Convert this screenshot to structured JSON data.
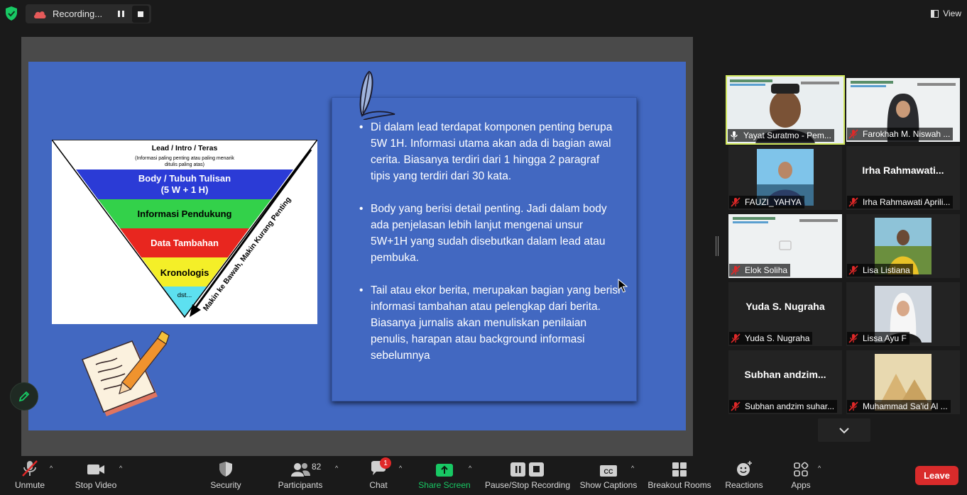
{
  "recording": {
    "label": "Recording..."
  },
  "view": {
    "label": "View"
  },
  "colors": {
    "accent_green": "#18c964",
    "active_speaker": "#d2e85d",
    "leave_red": "#d92b2b",
    "mute_red": "#e02828",
    "slide_blue": "#4268c1"
  },
  "slide": {
    "pyramid": {
      "top_title": "Lead / Intro / Teras",
      "top_note_1": "(Informasi paling penting atau paling menarik",
      "top_note_2": "ditulis paling atas)",
      "body_1": "Body / Tubuh Tulisan",
      "body_2": "(5 W + 1 H)",
      "level_3": "Informasi Pendukung",
      "level_4": "Data Tambahan",
      "level_5": "Kronologis",
      "level_6": "dst...",
      "arrow_label": "Makin ke Bawah, Makin Kurang Penting"
    },
    "bullets": [
      "Di dalam lead terdapat komponen penting berupa 5W 1H. Informasi utama akan ada di bagian awal cerita. Biasanya terdiri dari 1 hingga 2 paragraf tipis yang terdiri dari 30 kata.",
      "Body yang berisi detail penting. Jadi dalam body ada penjelasan lebih lanjut mengenai unsur 5W+1H yang sudah disebutkan dalam lead atau pembuka.",
      "Tail atau ekor berita, merupakan bagian yang berisi informasi tambahan atau pelengkap dari berita. Biasanya jurnalis akan menuliskan penilaian penulis, harapan atau background informasi sebelumnya"
    ]
  },
  "participants": [
    {
      "label": "Yayat Suratmo - Pem...",
      "muted": false,
      "active": true
    },
    {
      "label": "Farokhah M. Niswah ...",
      "muted": true
    },
    {
      "label": "FAUZI_YAHYA",
      "muted": true
    },
    {
      "name": "Irha  Rahmawati...",
      "label": "Irha Rahmawati Aprili...",
      "muted": true
    },
    {
      "label": "Elok Soliha",
      "muted": true
    },
    {
      "label": "Lisa Listiana",
      "muted": true
    },
    {
      "name": "Yuda S. Nugraha",
      "label": "Yuda S. Nugraha",
      "muted": true
    },
    {
      "label": "Lissa Ayu F",
      "muted": true
    },
    {
      "name": "Subhan  andzim...",
      "label": "Subhan andzim suhar...",
      "muted": true
    },
    {
      "label": "Muhammad Sa'id Al ...",
      "muted": true
    }
  ],
  "toolbar": {
    "unmute": "Unmute",
    "stop_video": "Stop Video",
    "security": "Security",
    "participants": "Participants",
    "participants_count": "82",
    "chat": "Chat",
    "chat_badge": "1",
    "share_screen": "Share Screen",
    "pause_recording": "Pause/Stop Recording",
    "captions": "Show Captions",
    "breakout": "Breakout Rooms",
    "reactions": "Reactions",
    "apps": "Apps",
    "leave": "Leave"
  }
}
